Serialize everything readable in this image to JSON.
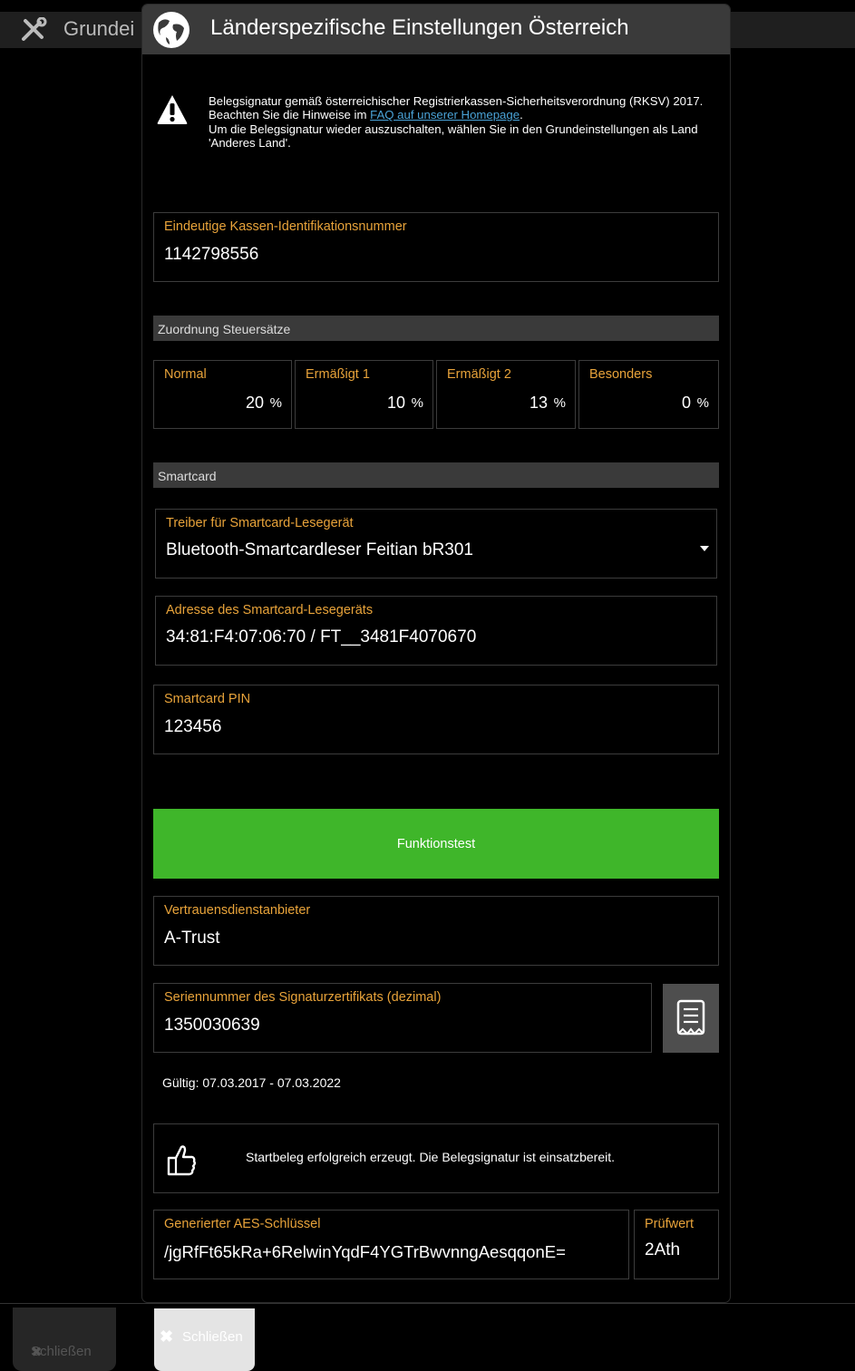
{
  "background": {
    "title": "Grundei",
    "close_label": "Schließen"
  },
  "dialog": {
    "title": "Länderspezifische Einstellungen Österreich",
    "notice": {
      "text1": "Belegsignatur gemäß österreichischer Registrierkassen-Sicherheitsverordnung (RKSV) 2017. Beachten Sie die Hinweise im ",
      "link": "FAQ auf unserer Homepage",
      "text2": ".",
      "text3": "Um die Belegsignatur wieder auszuschalten, wählen Sie in den Grundeinstellungen als Land 'Anderes Land'."
    },
    "kassen_id": {
      "label": "Eindeutige Kassen-Identifikationsnummer",
      "value": "1142798556"
    },
    "tax_section": "Zuordnung Steuersätze",
    "taxes": [
      {
        "label": "Normal",
        "value": "20",
        "unit": "%"
      },
      {
        "label": "Ermäßigt 1",
        "value": "10",
        "unit": "%"
      },
      {
        "label": "Ermäßigt 2",
        "value": "13",
        "unit": "%"
      },
      {
        "label": "Besonders",
        "value": "0",
        "unit": "%"
      }
    ],
    "smartcard_section": "Smartcard",
    "driver": {
      "label": "Treiber für Smartcard-Lesegerät",
      "value": "Bluetooth-Smartcardleser Feitian bR301"
    },
    "address": {
      "label": "Adresse des Smartcard-Lesegeräts",
      "value": "34:81:F4:07:06:70 / FT__3481F4070670"
    },
    "pin": {
      "label": "Smartcard PIN",
      "value": "123456"
    },
    "test_button": "Funktionstest",
    "provider": {
      "label": "Vertrauensdienstanbieter",
      "value": "A-Trust"
    },
    "serial": {
      "label": "Seriennummer des Signaturzertifikats (dezimal)",
      "value": "1350030639"
    },
    "validity": "Gültig: 07.03.2017 - 07.03.2022",
    "status": "Startbeleg erfolgreich erzeugt. Die Belegsignatur ist einsatzbereit.",
    "aes": {
      "label": "Generierter AES-Schlüssel",
      "value": "/jgRfFt65kRa+6RelwinYqdF4YGTrBwvnngAesqqonE="
    },
    "check": {
      "label": "Prüfwert",
      "value": "2Ath"
    },
    "close_label": "Schließen"
  },
  "colors": {
    "accent_label": "#e8a33a",
    "button_green": "#3fb62a",
    "link": "#4aa3d8",
    "header": "#3a3a3a"
  },
  "icons": [
    "tools-icon",
    "globe-icon",
    "warning-icon",
    "receipt-icon",
    "thumbs-up-icon",
    "close-icon",
    "dropdown-arrow-icon"
  ]
}
